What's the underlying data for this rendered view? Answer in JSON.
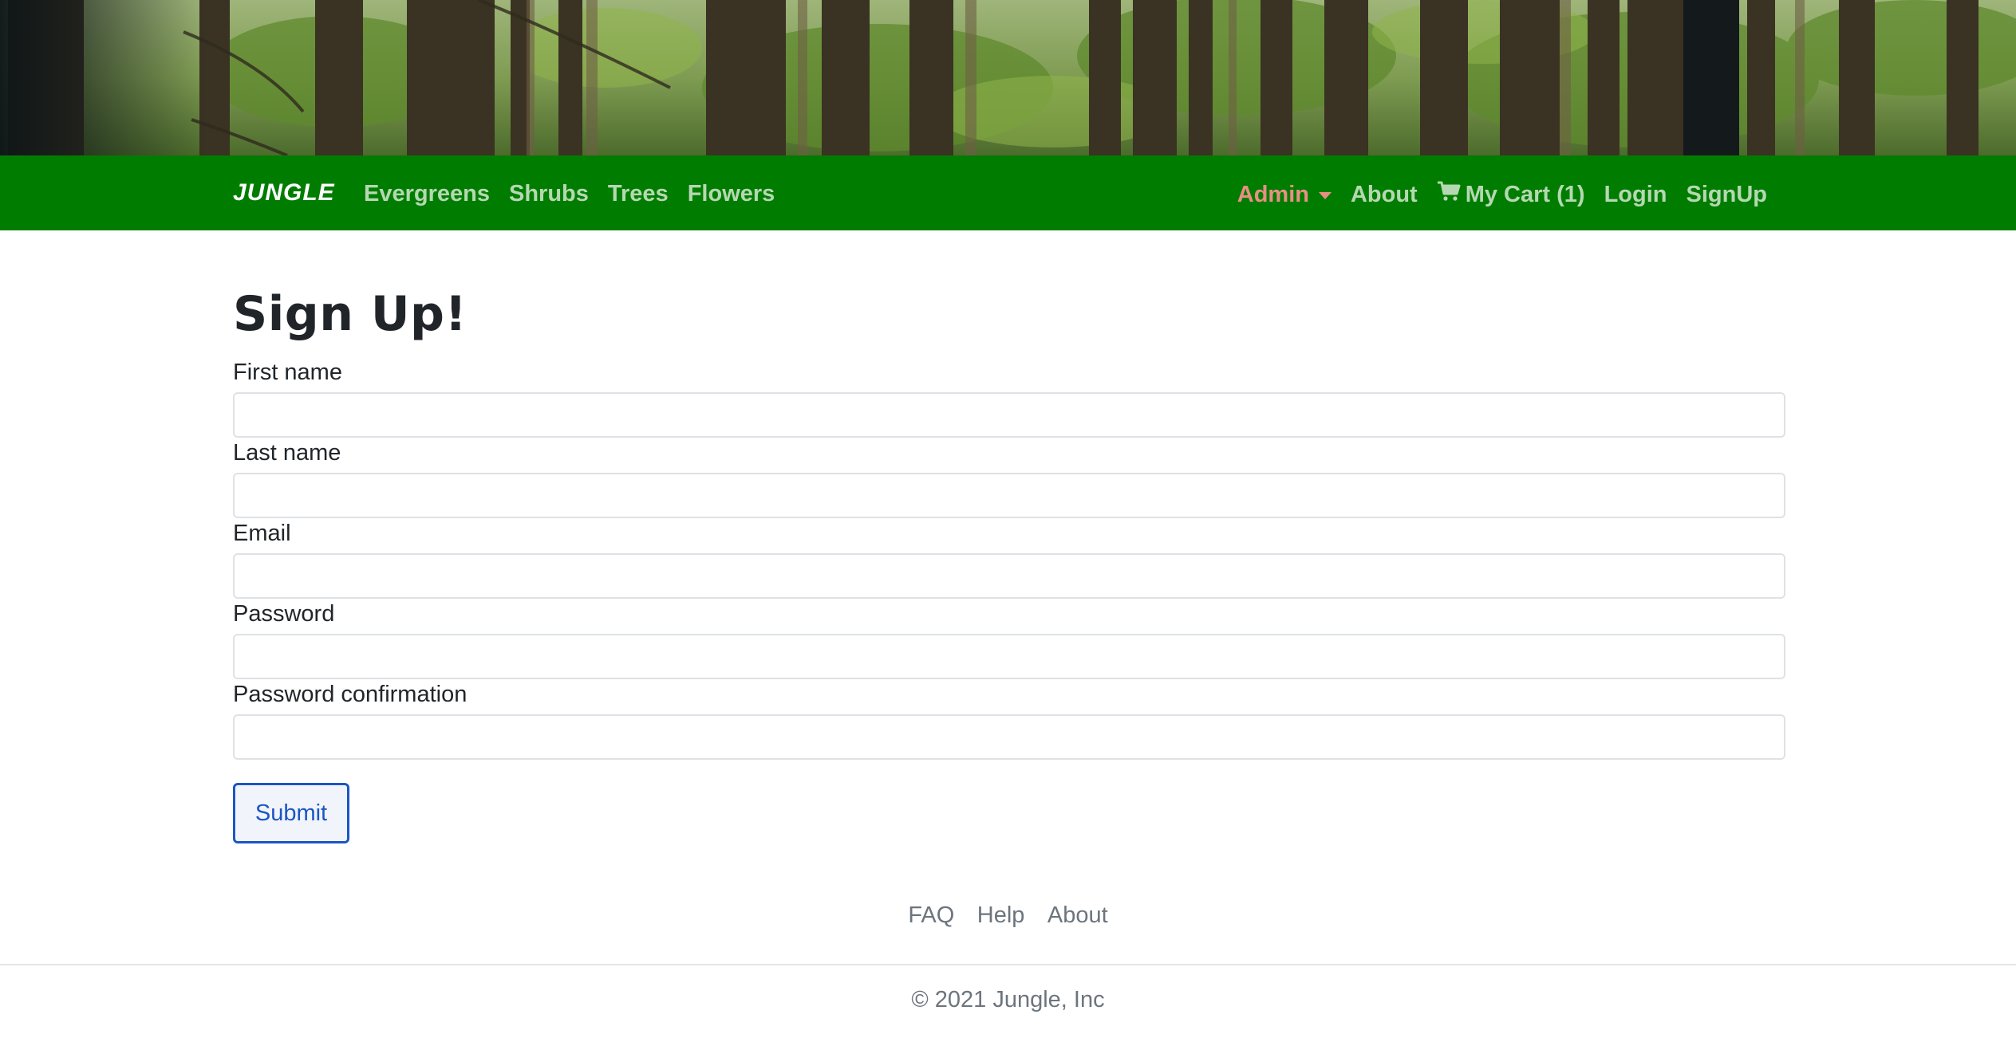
{
  "navbar": {
    "brand": "JUNGLE",
    "left_links": [
      {
        "label": "Evergreens"
      },
      {
        "label": "Shrubs"
      },
      {
        "label": "Trees"
      },
      {
        "label": "Flowers"
      }
    ],
    "admin_label": "Admin",
    "about_label": "About",
    "cart_label": "My Cart (1)",
    "login_label": "Login",
    "signup_label": "SignUp",
    "colors": {
      "background": "#007d00",
      "link": "#b5d8b2",
      "admin": "#e88f84"
    },
    "icons": {
      "cart": "shopping-cart-icon",
      "admin_caret": "caret-down-icon"
    }
  },
  "form": {
    "title": "Sign Up!",
    "fields": [
      {
        "label": "First name",
        "value": ""
      },
      {
        "label": "Last name",
        "value": ""
      },
      {
        "label": "Email",
        "value": ""
      },
      {
        "label": "Password",
        "value": ""
      },
      {
        "label": "Password confirmation",
        "value": ""
      }
    ],
    "submit_label": "Submit",
    "accent": "#1a56c4"
  },
  "footer": {
    "links": [
      {
        "label": "FAQ"
      },
      {
        "label": "Help"
      },
      {
        "label": "About"
      }
    ],
    "copyright": "© 2021 Jungle, Inc"
  }
}
